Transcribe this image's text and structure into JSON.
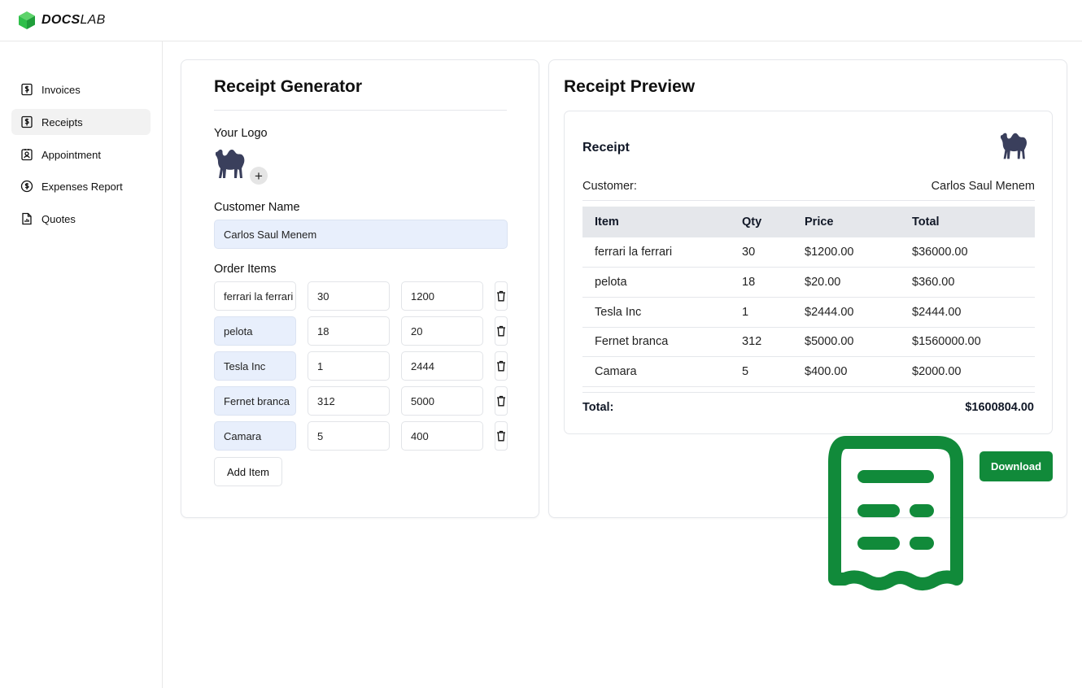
{
  "brand": {
    "name_bold": "DOCS",
    "name_light": "LAB",
    "accent": "#2fbf4a"
  },
  "sidebar": {
    "items": [
      {
        "label": "Invoices",
        "icon": "dollar-doc-icon",
        "active": false
      },
      {
        "label": "Receipts",
        "icon": "dollar-doc-icon",
        "active": true
      },
      {
        "label": "Appointment",
        "icon": "id-card-icon",
        "active": false
      },
      {
        "label": "Expenses Report",
        "icon": "dollar-circle-icon",
        "active": false
      },
      {
        "label": "Quotes",
        "icon": "chart-doc-icon",
        "active": false
      }
    ]
  },
  "generator": {
    "title": "Receipt Generator",
    "logo_label": "Your Logo",
    "logo_add_symbol": "+",
    "customer_label": "Customer Name",
    "customer_value": "Carlos Saul Menem",
    "order_label": "Order Items",
    "items": [
      {
        "name": "ferrari la ferrari",
        "qty": "30",
        "price": "1200"
      },
      {
        "name": "pelota",
        "qty": "18",
        "price": "20"
      },
      {
        "name": "Tesla Inc",
        "qty": "1",
        "price": "2444"
      },
      {
        "name": "Fernet branca",
        "qty": "312",
        "price": "5000"
      },
      {
        "name": "Camara",
        "qty": "5",
        "price": "400"
      }
    ],
    "add_item_label": "Add Item"
  },
  "preview": {
    "title": "Receipt Preview",
    "receipt_label": "Receipt",
    "customer_label": "Customer:",
    "customer_value": "Carlos Saul Menem",
    "headers": [
      "Item",
      "Qty",
      "Price",
      "Total"
    ],
    "rows": [
      [
        "ferrari la ferrari",
        "30",
        "$1200.00",
        "$36000.00"
      ],
      [
        "pelota",
        "18",
        "$20.00",
        "$360.00"
      ],
      [
        "Tesla Inc",
        "1",
        "$2444.00",
        "$2444.00"
      ],
      [
        "Fernet branca",
        "312",
        "$5000.00",
        "$1560000.00"
      ],
      [
        "Camara",
        "5",
        "$400.00",
        "$2000.00"
      ]
    ],
    "total_label": "Total:",
    "total_value": "$1600804.00",
    "download_label": "Download"
  },
  "colors": {
    "primary_green": "#118a3a",
    "input_filled_bg": "#e8effc",
    "logo_camel": "#3a3f5c"
  }
}
